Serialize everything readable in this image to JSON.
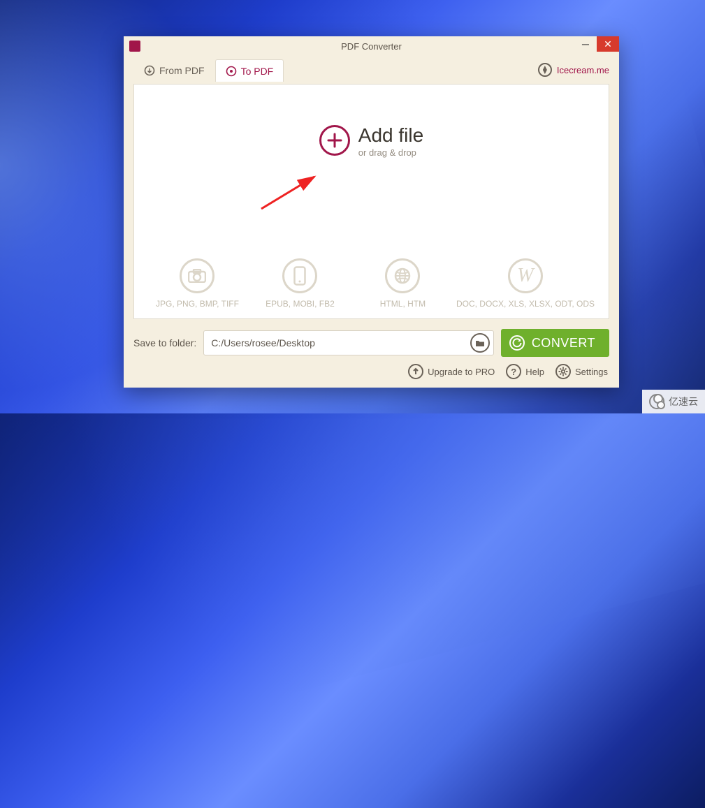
{
  "window": {
    "title": "PDF Converter",
    "branding_link": "Icecream.me"
  },
  "tabs": {
    "from_label": "From PDF",
    "to_label": "To PDF",
    "active": "to"
  },
  "add_file": {
    "title": "Add file",
    "subtitle": "or drag & drop"
  },
  "formats": [
    {
      "label": "JPG, PNG, BMP, TIFF",
      "icon": "camera"
    },
    {
      "label": "EPUB, MOBI, FB2",
      "icon": "phone"
    },
    {
      "label": "HTML, HTM",
      "icon": "globe"
    },
    {
      "label": "DOC, DOCX, XLS, XLSX, ODT, ODS",
      "icon": "w"
    }
  ],
  "save": {
    "label": "Save to folder:",
    "path": "C:/Users/rosee/Desktop"
  },
  "convert_label": "CONVERT",
  "footer": {
    "upgrade": "Upgrade to PRO",
    "help": "Help",
    "settings": "Settings"
  },
  "watermark": "亿速云"
}
